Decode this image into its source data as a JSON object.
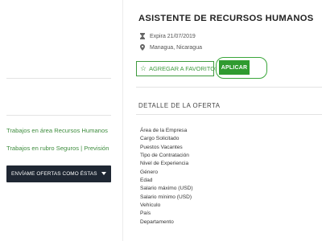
{
  "sidebar": {
    "links": [
      "Trabajos en área Recursos Humanos",
      "Trabajos en rubro Seguros | Previsión"
    ],
    "alert_button": "ENVÍAME OFERTAS COMO ÉSTAS"
  },
  "job": {
    "title": "ASISTENTE DE RECURSOS HUMANOS",
    "expires": "Expira 21/07/2019",
    "location": "Managua, Nicaragua",
    "favorite_label": "AGREGAR A FAVORITOS",
    "apply_label": "APLICAR"
  },
  "details": {
    "title": "DETALLE DE LA OFERTA",
    "fields": [
      "Área de la Empresa",
      "Cargo Solicitado",
      "Puestos Vacantes",
      "Tipo de Contratación",
      "Nivel de Experiencia",
      "Género",
      "Edad",
      "Salario máximo (USD)",
      "Salario mínimo (USD)",
      "Vehículo",
      "País",
      "Departamento"
    ]
  },
  "colors": {
    "accent_green": "#2f9b2f",
    "link_green": "#3f8d3f",
    "dark_button": "#1f2733"
  },
  "icons": {
    "expires": "hourglass-icon",
    "location": "map-pin-icon",
    "favorite": "star-outline-icon",
    "alert": "caret-down-icon"
  }
}
